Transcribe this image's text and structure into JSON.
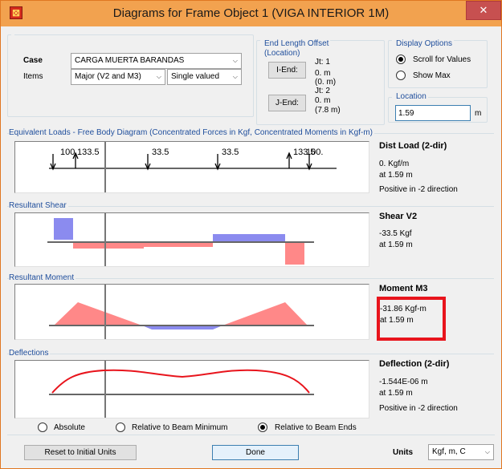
{
  "window": {
    "title": "Diagrams for Frame Object 1  (VIGA INTERIOR 1M)",
    "close": "✕",
    "app_icon": "⊠"
  },
  "case_items": {
    "case_label": "Case",
    "case_value": "CARGA MUERTA BARANDAS",
    "items_label": "Items",
    "items_value": "Major (V2 and M3)",
    "valued_value": "Single valued"
  },
  "end_length_offset": {
    "title_line1": "End Length Offset",
    "title_line2": "(Location)",
    "iend_button": "I-End:",
    "iend_jt": "Jt:  1",
    "iend_value": "0. m",
    "iend_loc": "(0. m)",
    "jend_button": "J-End:",
    "jend_jt": "Jt:  2",
    "jend_value": "0. m",
    "jend_loc": "(7.8 m)"
  },
  "display_options": {
    "title": "Display Options",
    "scroll": "Scroll for Values",
    "show_max": "Show Max",
    "selected": "scroll"
  },
  "location": {
    "title": "Location",
    "value": "1.59",
    "unit": "m"
  },
  "equivalent_loads": {
    "title": "Equivalent Loads - Free Body Diagram  (Concentrated Forces in Kgf, Concentrated Moments in Kgf-m)",
    "labels": [
      "100.",
      "133.5",
      "33.5",
      "33.5",
      "133.5",
      "100."
    ],
    "side_title": "Dist Load (2-dir)",
    "side_value": "0. Kgf/m",
    "side_at": "at 1.59 m",
    "side_dir": "Positive in -2 direction"
  },
  "shear": {
    "title": "Resultant Shear",
    "side_title": "Shear V2",
    "side_value": "-33.5 Kgf",
    "side_at": "at 1.59 m"
  },
  "moment": {
    "title": "Resultant Moment",
    "side_title": "Moment M3",
    "side_value": "-31.86 Kgf-m",
    "side_at": "at 1.59 m"
  },
  "deflection": {
    "title": "Deflections",
    "side_title": "Deflection (2-dir)",
    "side_value": "-1.544E-06 m",
    "side_at": "at 1.59 m",
    "side_dir": "Positive in -2 direction",
    "opt_absolute": "Absolute",
    "opt_relative_min": "Relative to Beam Minimum",
    "opt_relative_ends": "Relative to Beam Ends",
    "selected": "relative_ends"
  },
  "bottom": {
    "reset": "Reset to Initial Units",
    "done": "Done",
    "units_label": "Units",
    "units_value": "Kgf, m, C"
  },
  "colors": {
    "positive": "#ff8888",
    "negative": "#8b8bef",
    "highlight": "#e8141c",
    "deflection": "#e8141c",
    "section_title": "#1f4e9c"
  }
}
